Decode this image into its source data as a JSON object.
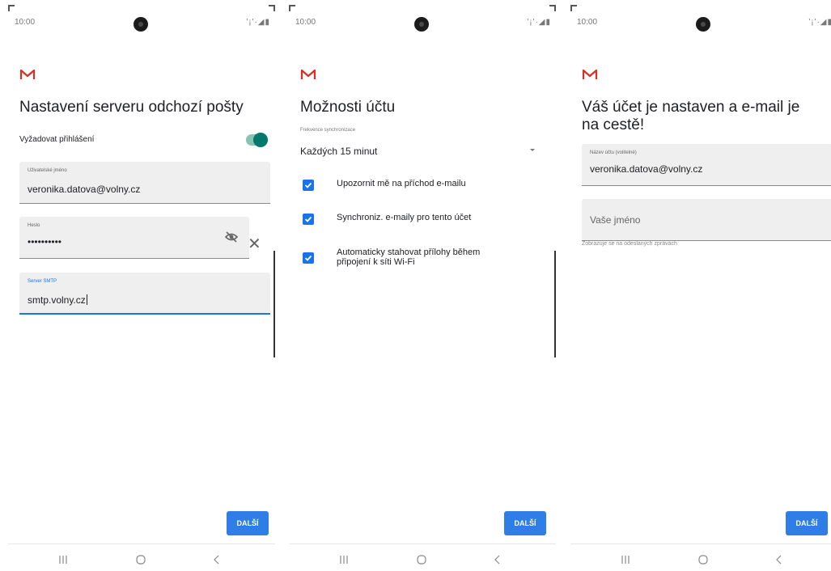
{
  "screens": [
    {
      "status": {
        "time": "10:00",
        "icons": "'¡'·◢▮"
      },
      "title": "Nastavení serveru odchozí pošty",
      "require_login": {
        "label": "Vyžadovat přihlášení",
        "enabled": true
      },
      "fields": {
        "username": {
          "label": "Uživatelské jméno",
          "value": "veronika.datova@volny.cz"
        },
        "password": {
          "label": "Heslo",
          "value": "••••••••••"
        },
        "smtp": {
          "label": "Server SMTP",
          "value": "smtp.volny.cz"
        }
      },
      "next_label": "DALŠÍ"
    },
    {
      "status": {
        "time": "10:00",
        "icons": "'¡'·◢▮"
      },
      "title": "Možnosti účtu",
      "sync_frequency": {
        "label": "Frekvence synchronizace",
        "value": "Každých 15 minut"
      },
      "checkboxes": [
        {
          "label": "Upozornit mě na příchod e-mailu",
          "checked": true
        },
        {
          "label": "Synchroniz. e-maily pro tento účet",
          "checked": true
        },
        {
          "label": "Automaticky stahovat přílohy během připojení k síti Wi-Fi",
          "checked": true
        }
      ],
      "next_label": "DALŠÍ"
    },
    {
      "status": {
        "time": "10:00",
        "icons": "'¡'·◢▮"
      },
      "title": "Váš účet je nastaven a e-mail je na cestě!",
      "fields": {
        "account_name": {
          "label": "Název účtu (volitelné)",
          "value": "veronika.datova@volny.cz"
        },
        "your_name": {
          "placeholder": "Vaše jméno",
          "hint": "Zobrazuje se na odeslaných zprávách"
        }
      },
      "next_label": "DALŠÍ"
    }
  ],
  "colors": {
    "accent": "#1a73e8",
    "button": "#2f7de6",
    "toggle": "#00796b",
    "gmail_red": "#d93025",
    "field_bg": "#efefef"
  },
  "icons": [
    "gmail-logo-icon",
    "visibility-off-icon",
    "close-icon",
    "checkbox-icon",
    "dropdown-arrow-icon",
    "recent-apps-icon",
    "home-icon",
    "back-icon"
  ]
}
